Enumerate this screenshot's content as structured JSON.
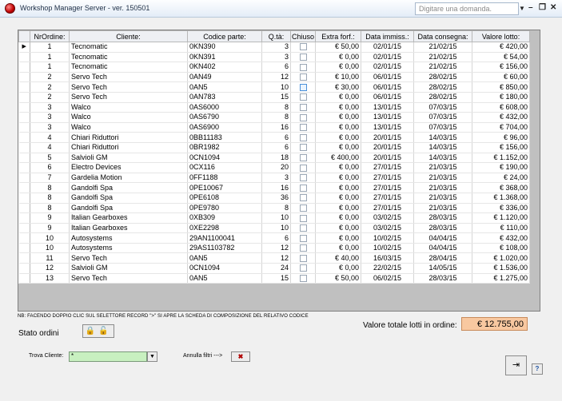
{
  "window": {
    "title": "Workshop Manager Server - ver. 150501",
    "search_placeholder": "Digitare una domanda.",
    "minimize": "–",
    "restore": "❐",
    "close": "✕"
  },
  "grid": {
    "columns": [
      "NrOrdine:",
      "Cliente:",
      "Codice parte:",
      "Q.tà:",
      "Chiuso",
      "Extra forf.:",
      "Data immiss.:",
      "Data consegna:",
      "Valore lotto:"
    ],
    "selector_glyph": "▶",
    "rows": [
      [
        "1",
        "Tecnomatic",
        "0KN390",
        "3",
        "€ 50,00",
        "02/01/15",
        "21/02/15",
        "€ 420,00"
      ],
      [
        "1",
        "Tecnomatic",
        "0KN391",
        "3",
        "€ 0,00",
        "02/01/15",
        "21/02/15",
        "€ 54,00"
      ],
      [
        "1",
        "Tecnomatic",
        "0KN402",
        "6",
        "€ 0,00",
        "02/01/15",
        "21/02/15",
        "€ 156,00"
      ],
      [
        "2",
        "Servo Tech",
        "0AN49",
        "12",
        "€ 10,00",
        "06/01/15",
        "28/02/15",
        "€ 60,00"
      ],
      [
        "2",
        "Servo Tech",
        "0AN5",
        "10",
        "€ 30,00",
        "06/01/15",
        "28/02/15",
        "€ 850,00"
      ],
      [
        "2",
        "Servo Tech",
        "0AN783",
        "15",
        "€ 0,00",
        "06/01/15",
        "28/02/15",
        "€ 180,00"
      ],
      [
        "3",
        "Walco",
        "0AS6000",
        "8",
        "€ 0,00",
        "13/01/15",
        "07/03/15",
        "€ 608,00"
      ],
      [
        "3",
        "Walco",
        "0AS6790",
        "8",
        "€ 0,00",
        "13/01/15",
        "07/03/15",
        "€ 432,00"
      ],
      [
        "3",
        "Walco",
        "0AS6900",
        "16",
        "€ 0,00",
        "13/01/15",
        "07/03/15",
        "€ 704,00"
      ],
      [
        "4",
        "Chiari Riduttori",
        "0BB11183",
        "6",
        "€ 0,00",
        "20/01/15",
        "14/03/15",
        "€ 96,00"
      ],
      [
        "4",
        "Chiari Riduttori",
        "0BR1982",
        "6",
        "€ 0,00",
        "20/01/15",
        "14/03/15",
        "€ 156,00"
      ],
      [
        "5",
        "Salvioli GM",
        "0CN1094",
        "18",
        "€ 400,00",
        "20/01/15",
        "14/03/15",
        "€ 1.152,00"
      ],
      [
        "6",
        "Electro Devices",
        "0CX116",
        "20",
        "€ 0,00",
        "27/01/15",
        "21/03/15",
        "€ 190,00"
      ],
      [
        "7",
        "Gardelia Motion",
        "0FF1188",
        "3",
        "€ 0,00",
        "27/01/15",
        "21/03/15",
        "€ 24,00"
      ],
      [
        "8",
        "Gandolfi Spa",
        "0PE10067",
        "16",
        "€ 0,00",
        "27/01/15",
        "21/03/15",
        "€ 368,00"
      ],
      [
        "8",
        "Gandolfi Spa",
        "0PE6108",
        "36",
        "€ 0,00",
        "27/01/15",
        "21/03/15",
        "€ 1.368,00"
      ],
      [
        "8",
        "Gandolfi Spa",
        "0PE9780",
        "8",
        "€ 0,00",
        "27/01/15",
        "21/03/15",
        "€ 336,00"
      ],
      [
        "9",
        "Italian Gearboxes",
        "0XB309",
        "10",
        "€ 0,00",
        "03/02/15",
        "28/03/15",
        "€ 1.120,00"
      ],
      [
        "9",
        "Italian Gearboxes",
        "0XE2298",
        "10",
        "€ 0,00",
        "03/02/15",
        "28/03/15",
        "€ 110,00"
      ],
      [
        "10",
        "Autosystems",
        "29AN1100041",
        "6",
        "€ 0,00",
        "10/02/15",
        "04/04/15",
        "€ 432,00"
      ],
      [
        "10",
        "Autosystems",
        "29AS1103782",
        "12",
        "€ 0,00",
        "10/02/15",
        "04/04/15",
        "€ 108,00"
      ],
      [
        "11",
        "Servo Tech",
        "0AN5",
        "12",
        "€ 40,00",
        "16/03/15",
        "28/04/15",
        "€ 1.020,00"
      ],
      [
        "12",
        "Salvioli GM",
        "0CN1094",
        "24",
        "€ 0,00",
        "22/02/15",
        "14/05/15",
        "€ 1.536,00"
      ],
      [
        "13",
        "Servo Tech",
        "0AN5",
        "15",
        "€ 50,00",
        "06/02/15",
        "28/03/15",
        "€ 1.275,00"
      ]
    ]
  },
  "footer": {
    "note": "NB: FACENDO DOPPIO CLIC SUL SELETTORE RECORD \">\" SI APRE LA SCHEDA DI COMPOSIZIONE DEL RELATIVO CODICE",
    "total_label": "Valore totale lotti in ordine:",
    "total_value": "€ 12.755,00",
    "status_label": "Stato ordini",
    "status_icons": "🔒🔓",
    "find_label": "Trova Cliente:",
    "find_value": "*",
    "dropdown_glyph": "▼",
    "reset_label": "Annulla filtri --->",
    "reset_glyph": "✖",
    "exit_glyph": "⇥",
    "help_glyph": "?"
  },
  "colors": {
    "total_bg": "#f8c8a0",
    "find_bg": "#c8f0c0",
    "app_icon": "#c00000"
  }
}
